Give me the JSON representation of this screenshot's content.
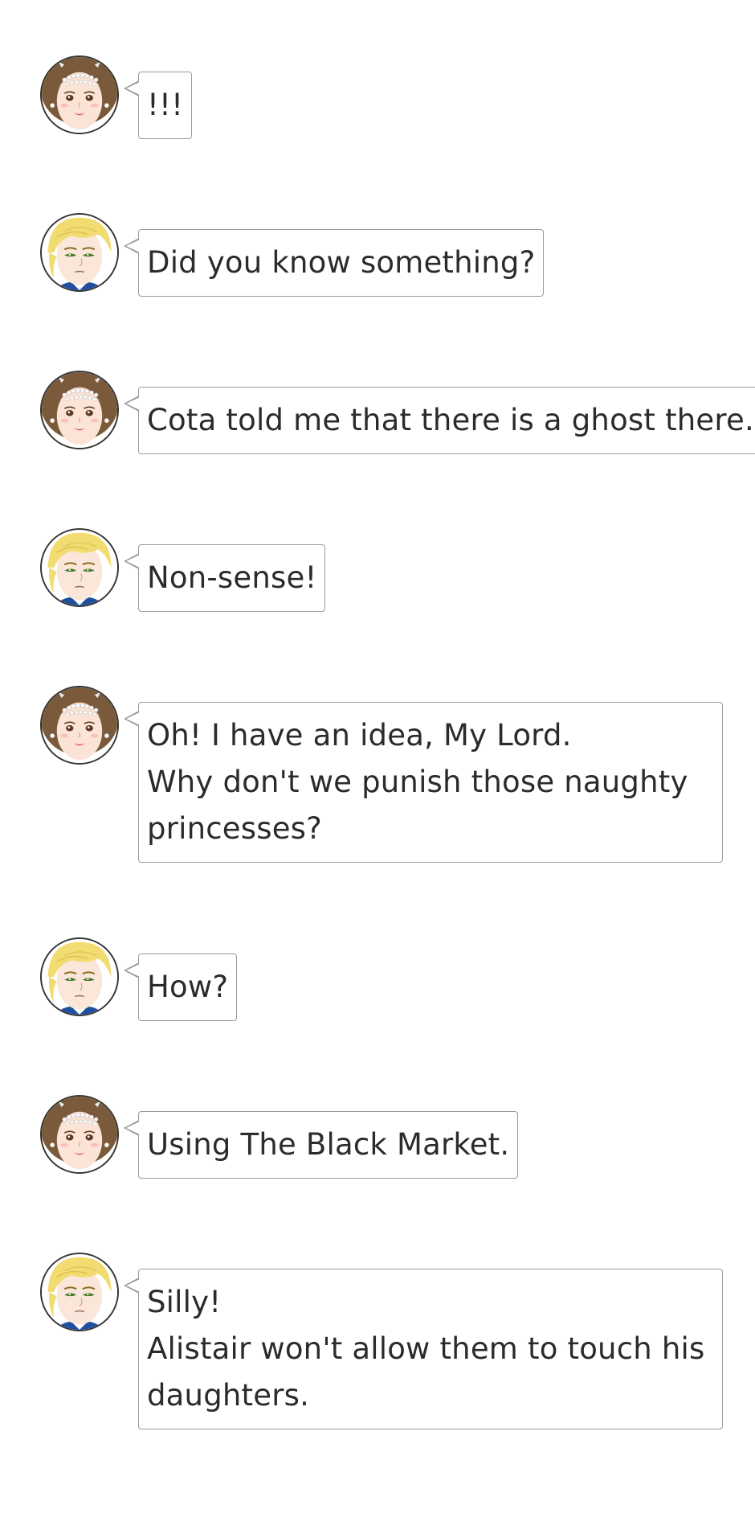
{
  "messages": [
    {
      "speaker": "lady",
      "lines": [
        "!!!"
      ]
    },
    {
      "speaker": "lord",
      "lines": [
        "Did you know something?"
      ]
    },
    {
      "speaker": "lady",
      "lines": [
        "Cota told me that there is a ghost there."
      ]
    },
    {
      "speaker": "lord",
      "lines": [
        "Non-sense!"
      ]
    },
    {
      "speaker": "lady",
      "lines": [
        "Oh! I have an idea, My Lord.",
        "Why don't we punish those naughty princesses?"
      ]
    },
    {
      "speaker": "lord",
      "lines": [
        "How?"
      ]
    },
    {
      "speaker": "lady",
      "lines": [
        "Using The Black Market."
      ]
    },
    {
      "speaker": "lord",
      "lines": [
        "Silly!",
        "Alistair won't allow them to touch his daughters."
      ]
    }
  ],
  "icons": {
    "lady": "lady-avatar-icon",
    "lord": "lord-avatar-icon"
  },
  "colors": {
    "bubble_border": "#9a9a9a",
    "text": "#2b2b2b",
    "avatar_border": "#333333",
    "lady_hair": "#7a5a3a",
    "lord_hair": "#f2dc72"
  }
}
